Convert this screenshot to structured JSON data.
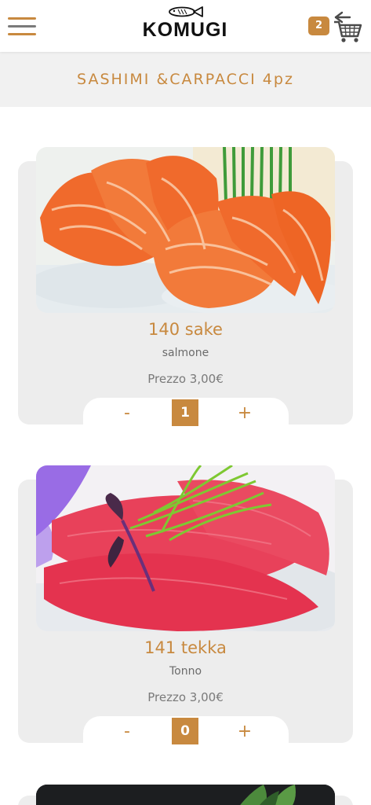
{
  "header": {
    "logo_text": "KOMUGI",
    "cart_count": "2"
  },
  "category": {
    "title": "SASHIMI &CARPACCI 4pz"
  },
  "products": [
    {
      "title": "140 sake",
      "subtitle": "salmone",
      "price": "Prezzo 3,00€",
      "quantity": "1",
      "minus_label": "-",
      "plus_label": "+"
    },
    {
      "title": "141 tekka",
      "subtitle": "Tonno",
      "price": "Prezzo 3,00€",
      "quantity": "0",
      "minus_label": "-",
      "plus_label": "+"
    }
  ],
  "colors": {
    "accent": "#c8893f",
    "card_bg": "#ededed",
    "category_bg": "#f1f1f1"
  },
  "icons": {
    "menu": "hamburger-menu-icon",
    "logo": "fish-icon",
    "cart": "shopping-cart-icon"
  }
}
